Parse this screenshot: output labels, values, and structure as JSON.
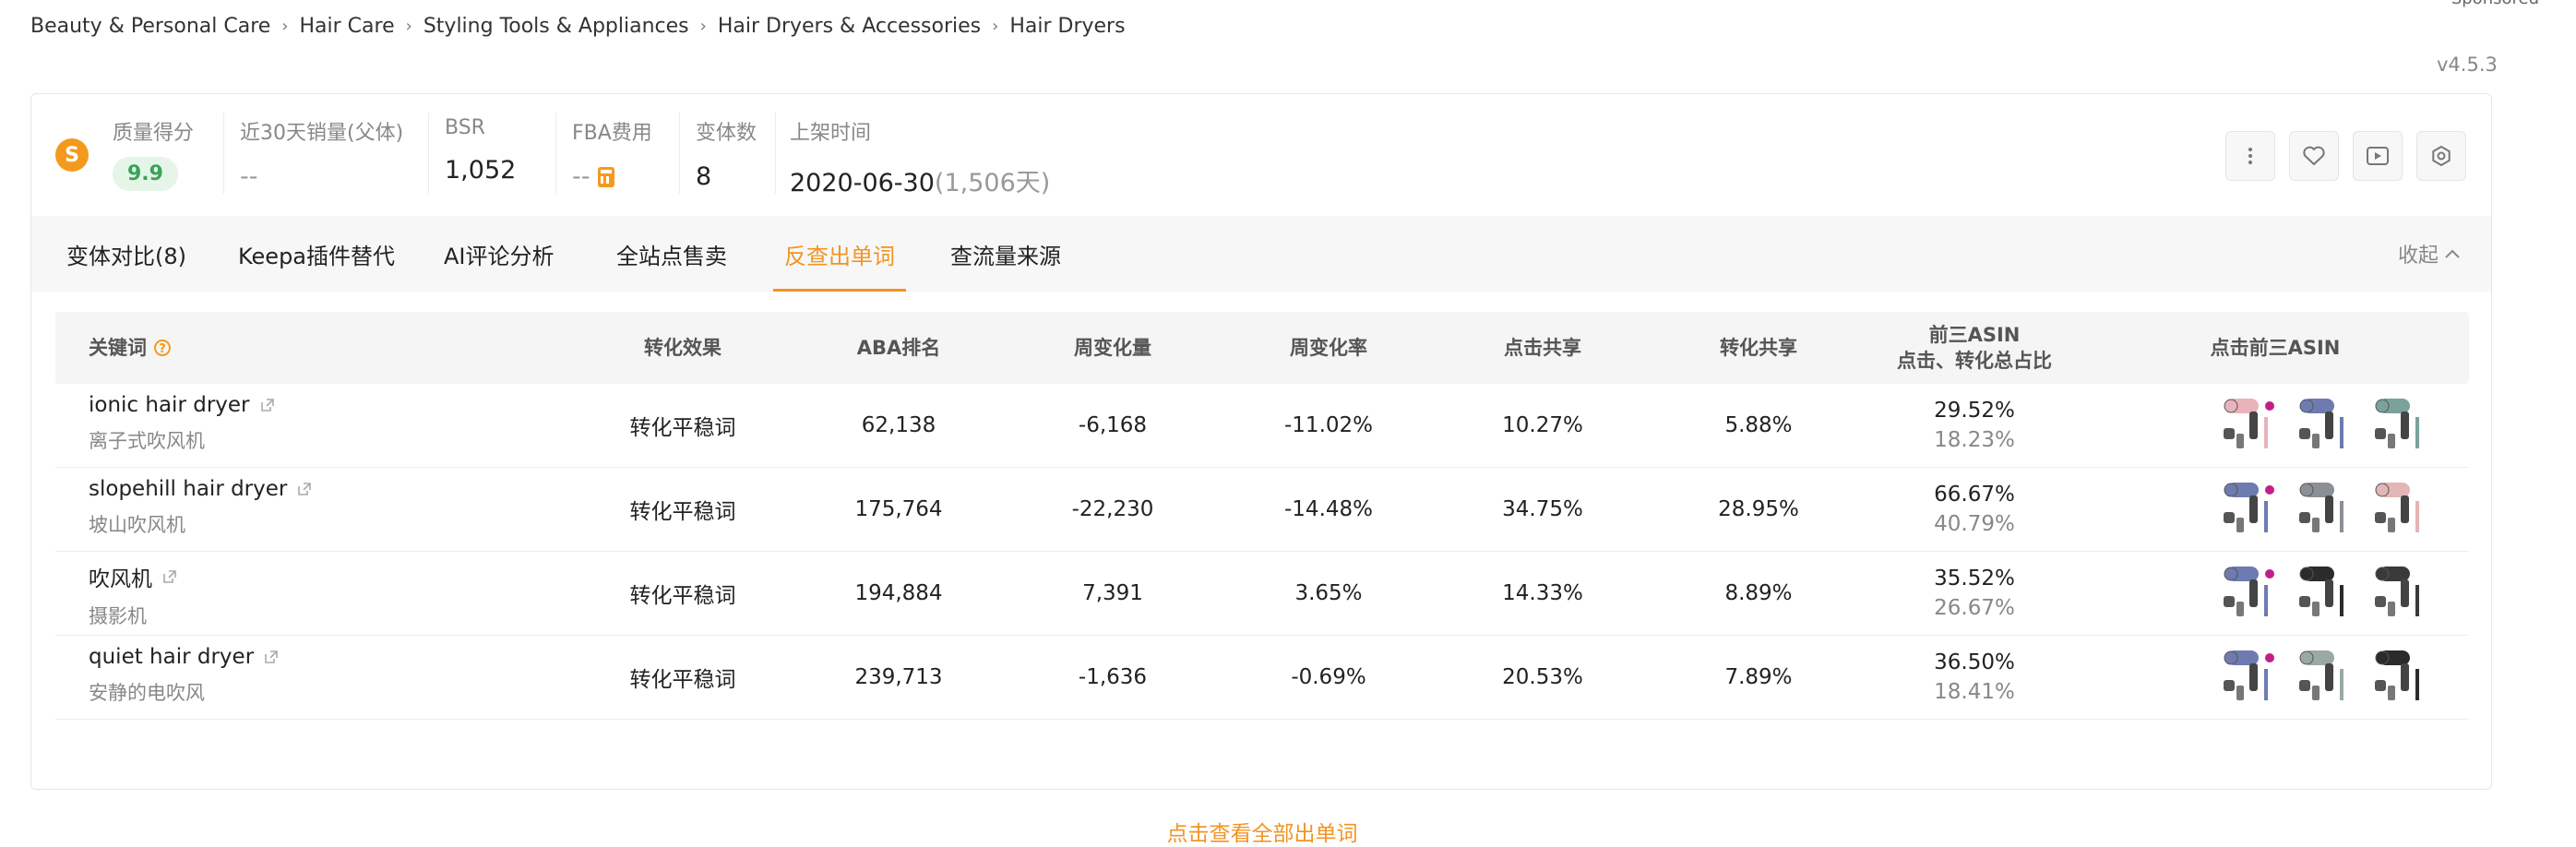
{
  "sponsored": "Sponsored",
  "breadcrumb": [
    "Beauty & Personal Care",
    "Hair Care",
    "Styling Tools & Appliances",
    "Hair Dryers & Accessories",
    "Hair Dryers"
  ],
  "version": "v4.5.3",
  "logo_letter": "S",
  "metrics": {
    "quality": {
      "label": "质量得分",
      "value": "9.9"
    },
    "sales30": {
      "label": "近30天销量(父体)",
      "value": "--"
    },
    "bsr": {
      "label": "BSR",
      "value": "1,052"
    },
    "fba": {
      "label": "FBA费用",
      "value": "--"
    },
    "variants": {
      "label": "变体数",
      "value": "8"
    },
    "listed": {
      "label": "上架时间",
      "date": "2020-06-30",
      "days": "(1,506天)"
    }
  },
  "tabs": [
    {
      "label": "变体对比(8)"
    },
    {
      "label": "Keepa插件替代"
    },
    {
      "label": "AI评论分析"
    },
    {
      "label": "全站点售卖"
    },
    {
      "label": "反查出单词"
    },
    {
      "label": "查流量来源"
    }
  ],
  "active_tab": "反查出单词",
  "collapse_label": "收起",
  "table": {
    "headers": {
      "keyword": "关键词",
      "effect": "转化效果",
      "aba": "ABA排名",
      "weekly_change": "周变化量",
      "weekly_rate": "周变化率",
      "click_share": "点击共享",
      "conv_share": "转化共享",
      "top3_ratio_line1": "前三ASIN",
      "top3_ratio_line2": "点击、转化总占比",
      "top3_asin": "点击前三ASIN"
    },
    "rows": [
      {
        "keyword": "ionic hair dryer",
        "translation": "离子式吹风机",
        "effect": "转化平稳词",
        "aba": "62,138",
        "weekly_change": "-6,168",
        "weekly_rate": "-11.02%",
        "click_share": "10.27%",
        "conv_share": "5.88%",
        "top3_click": "29.52%",
        "top3_conv": "18.23%"
      },
      {
        "keyword": "slopehill hair dryer",
        "translation": "坡山吹风机",
        "effect": "转化平稳词",
        "aba": "175,764",
        "weekly_change": "-22,230",
        "weekly_rate": "-14.48%",
        "click_share": "34.75%",
        "conv_share": "28.95%",
        "top3_click": "66.67%",
        "top3_conv": "40.79%"
      },
      {
        "keyword": "吹风机",
        "translation": "摄影机",
        "effect": "转化平稳词",
        "aba": "194,884",
        "weekly_change": "7,391",
        "weekly_rate": "3.65%",
        "click_share": "14.33%",
        "conv_share": "8.89%",
        "top3_click": "35.52%",
        "top3_conv": "26.67%"
      },
      {
        "keyword": "quiet hair dryer",
        "translation": "安静的电吹风",
        "effect": "转化平稳词",
        "aba": "239,713",
        "weekly_change": "-1,636",
        "weekly_rate": "-0.69%",
        "click_share": "20.53%",
        "conv_share": "7.89%",
        "top3_click": "36.50%",
        "top3_conv": "18.41%"
      }
    ]
  },
  "footer_link": "点击查看全部出单词",
  "colors": {
    "accent": "#f29423",
    "score_green": "#3aa35a"
  }
}
